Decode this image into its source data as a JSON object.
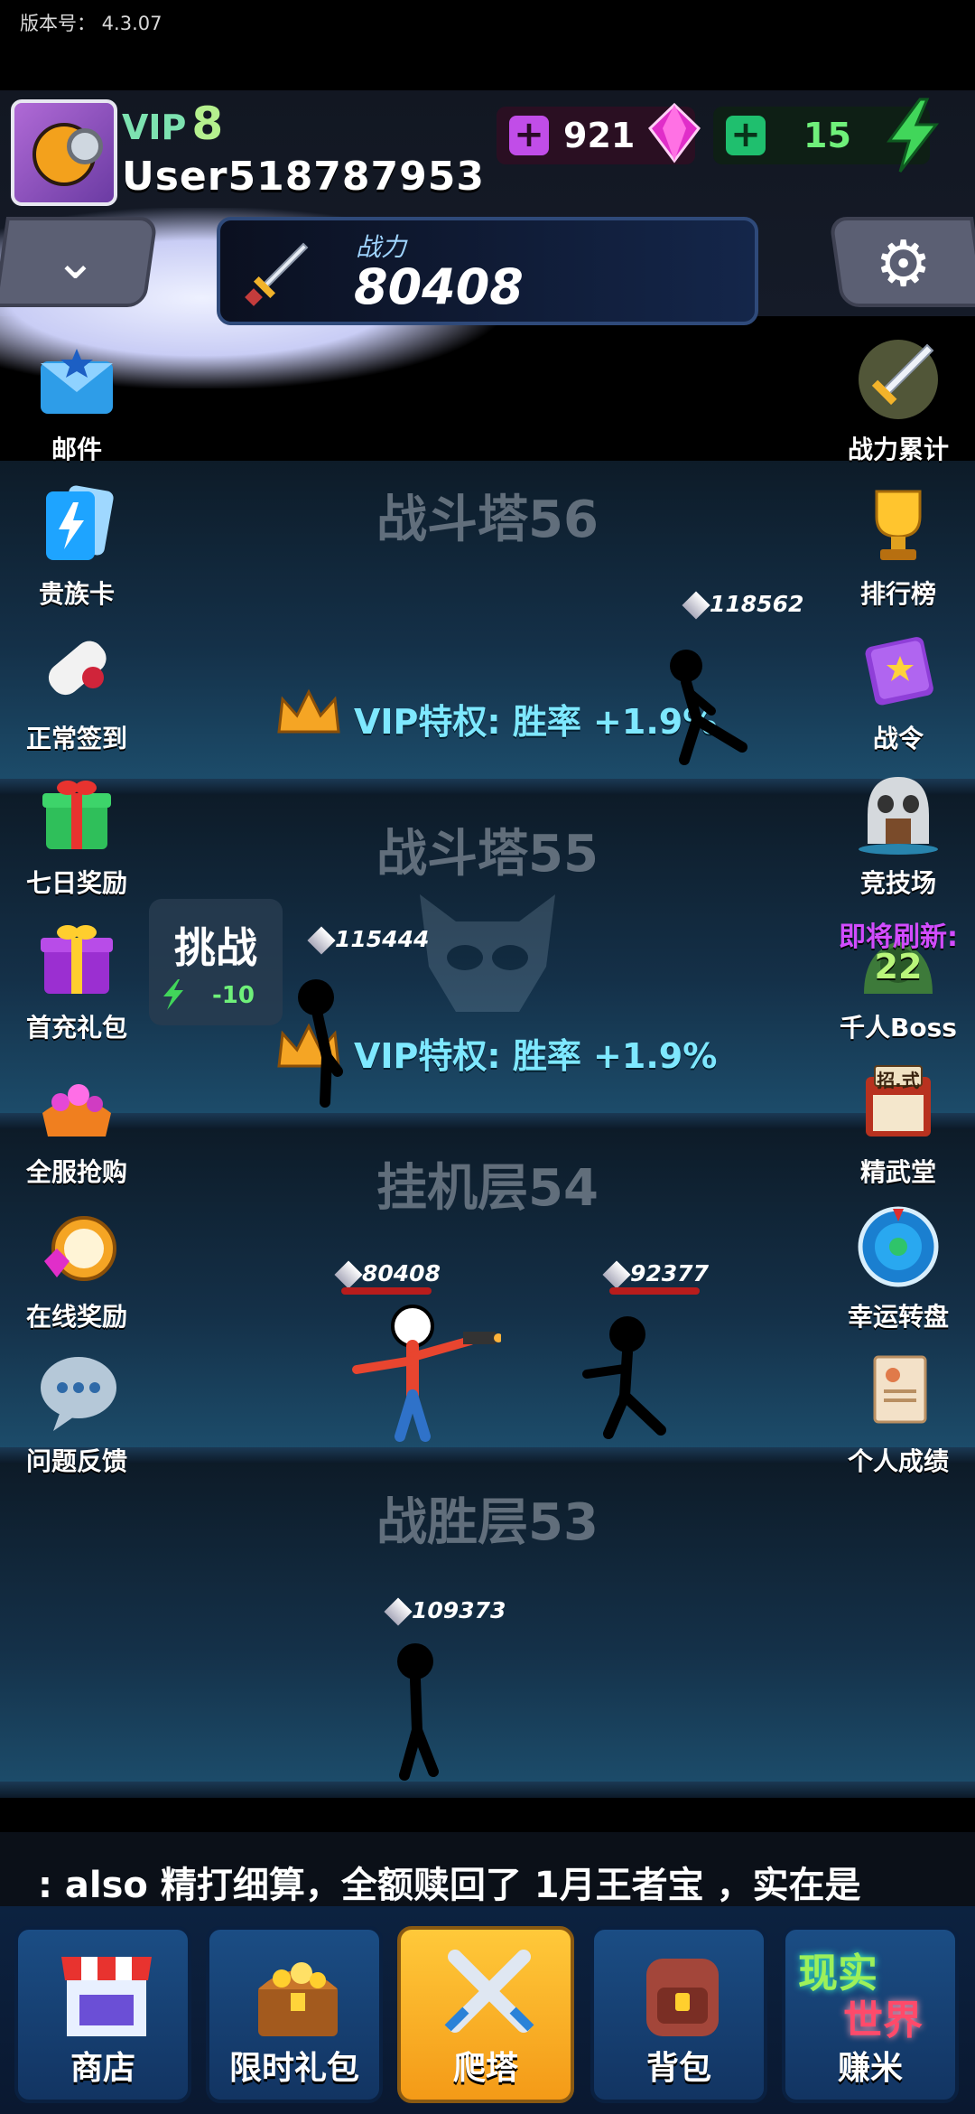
{
  "version_label": "版本号：  4.3.07",
  "player": {
    "vip_prefix": "VIP",
    "vip_level": "8",
    "username": "User518787953"
  },
  "resources": {
    "gems": "921",
    "energy": "15"
  },
  "power_panel": {
    "label": "战力",
    "value": "80408"
  },
  "left_menu": [
    {
      "label": "邮件",
      "icon": "mail-icon"
    },
    {
      "label": "贵族卡",
      "icon": "noble-card-icon"
    },
    {
      "label": "正常签到",
      "icon": "scroll-checkin-icon"
    },
    {
      "label": "七日奖励",
      "icon": "gift-box-green-icon"
    },
    {
      "label": "首充礼包",
      "icon": "gift-box-purple-icon"
    },
    {
      "label": "全服抢购",
      "icon": "treasure-icon"
    },
    {
      "label": "在线奖励",
      "icon": "stopwatch-gem-icon"
    },
    {
      "label": "问题反馈",
      "icon": "chat-bubble-icon"
    }
  ],
  "right_menu": [
    {
      "label": "战力累计",
      "icon": "sword-glow-icon"
    },
    {
      "label": "排行榜",
      "icon": "trophy-icon"
    },
    {
      "label": "战令",
      "icon": "purple-book-icon"
    },
    {
      "label": "竞技场",
      "icon": "skull-gate-icon"
    },
    {
      "label": "千人Boss",
      "icon": "boss-icon",
      "overlay_title": "即将刷新:",
      "overlay_count": "22"
    },
    {
      "label": "精武堂",
      "icon": "dojo-icon",
      "sign": "招.式"
    },
    {
      "label": "幸运转盘",
      "icon": "wheel-icon"
    },
    {
      "label": "个人成绩",
      "icon": "report-icon"
    }
  ],
  "floors": [
    {
      "title": "战斗塔56",
      "buff": "VIP特权: 胜率 +1.9%",
      "enemy_power": "118562"
    },
    {
      "title": "战斗塔55",
      "buff": "VIP特权: 胜率 +1.9%",
      "enemy_power": "115444",
      "challenge": {
        "label": "挑战",
        "cost": "-10"
      }
    },
    {
      "title": "挂机层54",
      "player_power": "80408",
      "enemy_power": "92377"
    },
    {
      "title": "战胜层53",
      "enemy_power": "109373"
    }
  ],
  "ticker": ": also 精打细算，全额赎回了 1月王者宝 ，实在是",
  "bottom_nav": [
    {
      "label": "商店",
      "icon": "shop-icon",
      "active": false
    },
    {
      "label": "限时礼包",
      "icon": "treasure-chest-icon",
      "active": false
    },
    {
      "label": "爬塔",
      "icon": "crossed-swords-icon",
      "active": true
    },
    {
      "label": "背包",
      "icon": "backpack-icon",
      "active": false
    },
    {
      "label": "赚米",
      "icon": "real-world-icon",
      "active": false,
      "badge_top": "现实",
      "badge_bottom": "世界"
    }
  ]
}
